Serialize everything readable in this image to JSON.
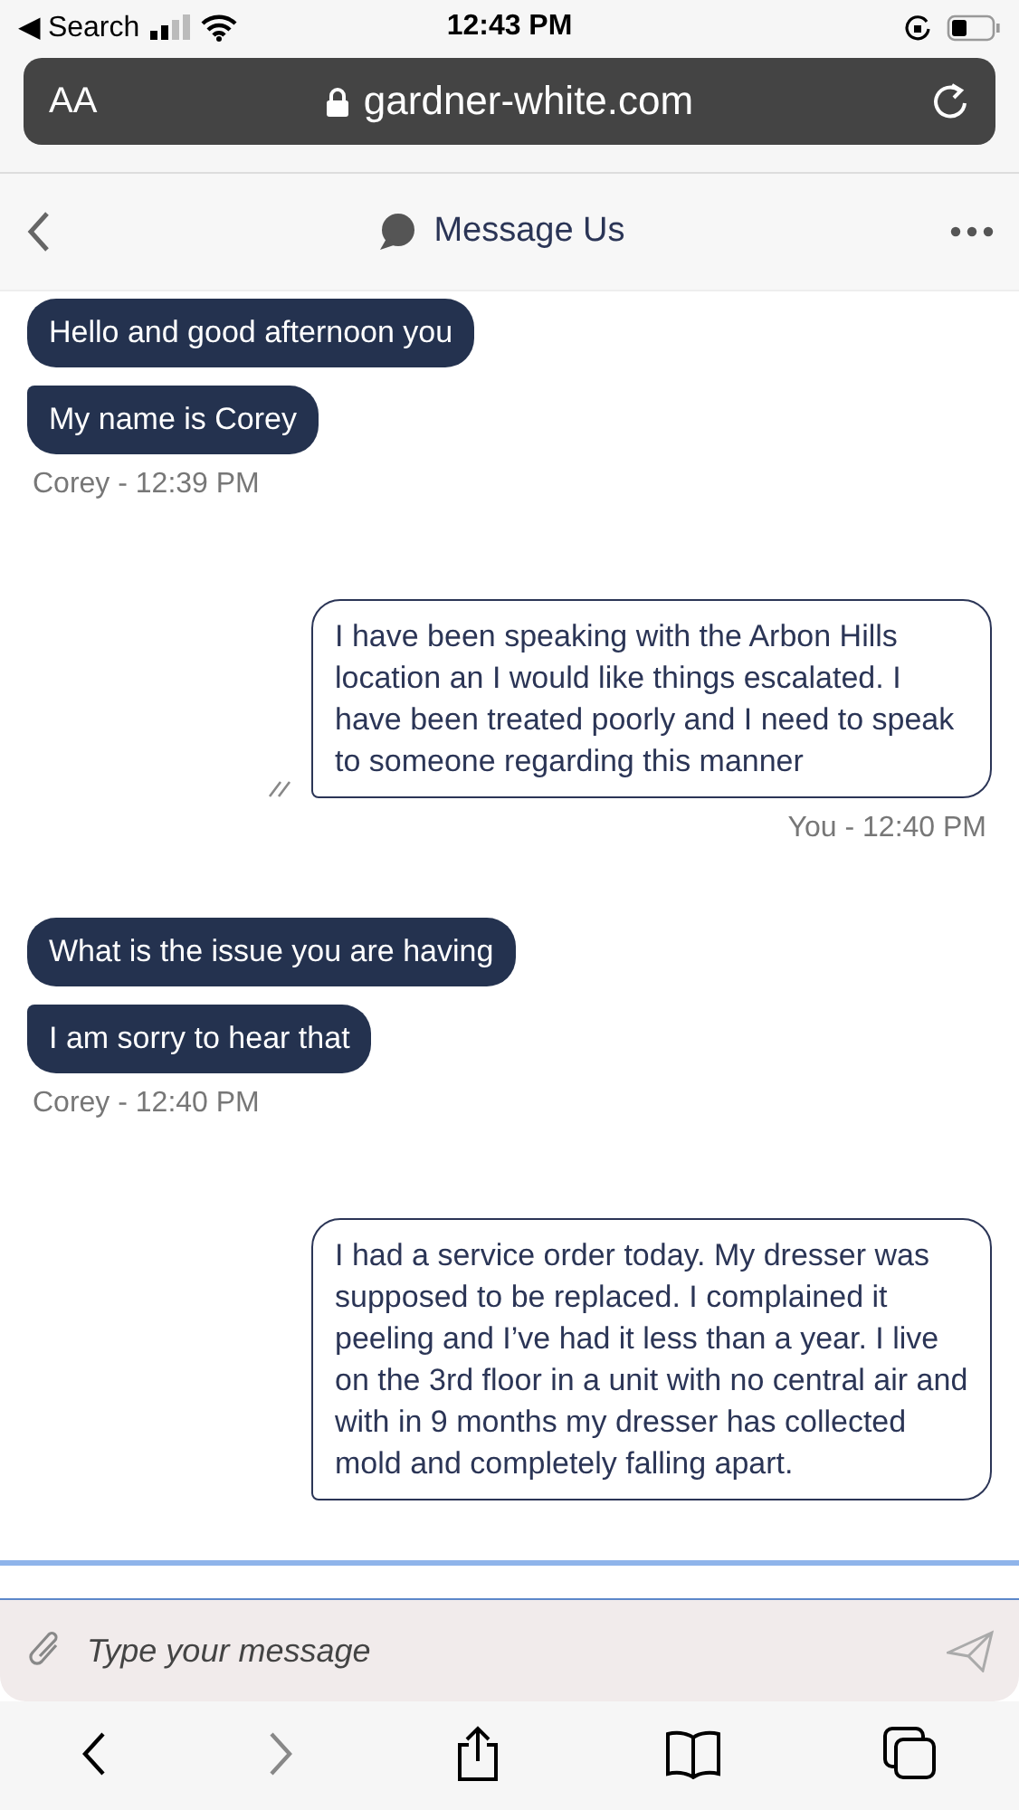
{
  "status_bar": {
    "back_app": "◀ Search",
    "time": "12:43 PM"
  },
  "url_bar": {
    "text_size": "AA",
    "url": "gardner-white.com"
  },
  "chat_header": {
    "title": "Message Us"
  },
  "groups": [
    {
      "kind": "agent",
      "messages": [
        "Hello and good afternoon you",
        "My name is Corey"
      ],
      "meta": "Corey - 12:39 PM"
    },
    {
      "kind": "user",
      "messages": [
        "I have been speaking with the Arbon Hills location an I would like things escalated. I have been treated poorly and I need to speak to someone regarding this manner"
      ],
      "meta": "You - 12:40 PM",
      "read": true
    },
    {
      "kind": "agent",
      "messages": [
        "What is the issue you are having",
        "I am sorry to hear that"
      ],
      "meta": "Corey - 12:40 PM"
    },
    {
      "kind": "user",
      "messages": [
        "I had a service order today. My dresser was supposed to be replaced. I complained it peeling and I’ve had it less than a year. I live on the 3rd floor in a unit with no central air and with in 9 months my dresser has collected mold and completely falling apart."
      ],
      "read": false
    }
  ],
  "composer": {
    "placeholder": "Type your message"
  }
}
